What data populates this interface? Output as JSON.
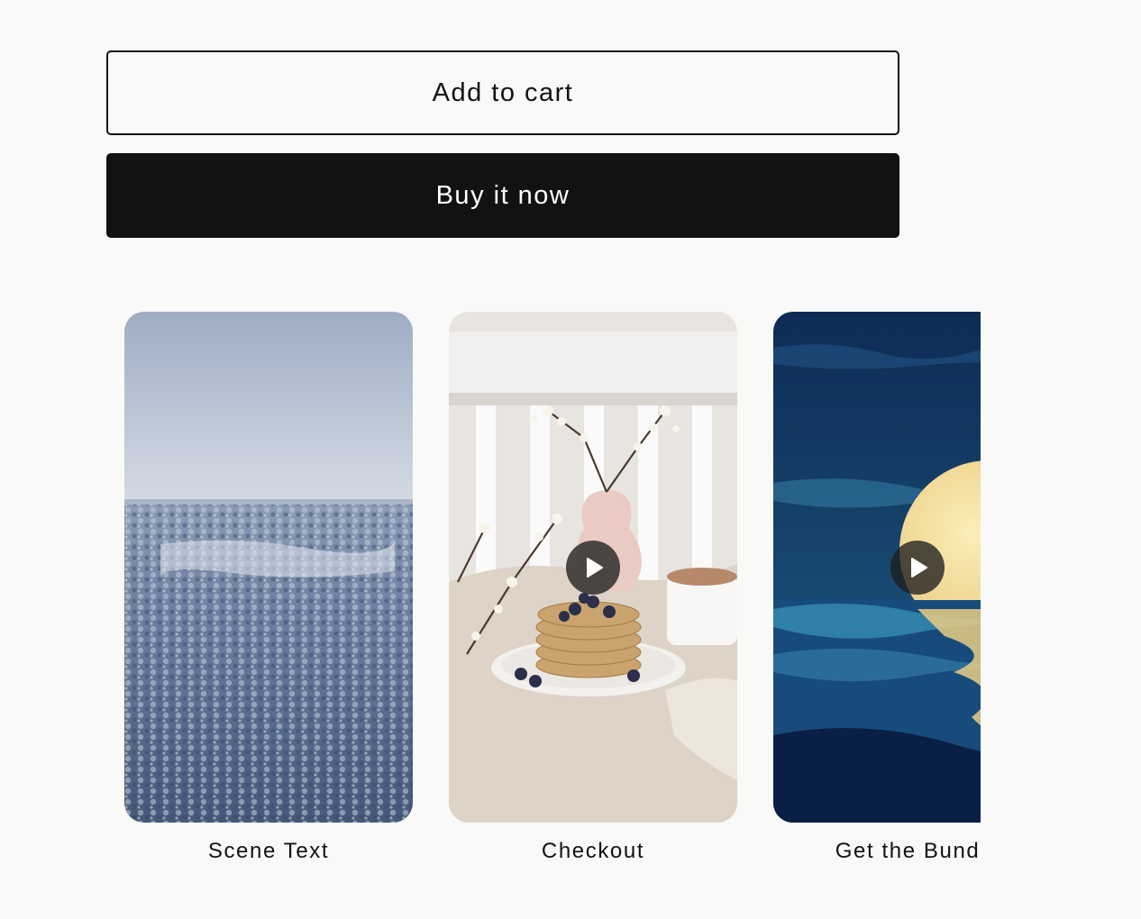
{
  "actions": {
    "add_to_cart_label": "Add to cart",
    "buy_now_label": "Buy it now"
  },
  "videos": [
    {
      "caption": "Scene Text",
      "thumbnail": "snowy-forest-landscape",
      "has_play_icon": false
    },
    {
      "caption": "Checkout",
      "thumbnail": "pancakes-breakfast",
      "has_play_icon": true,
      "icon": "play-icon"
    },
    {
      "caption": "Get the Bundle",
      "thumbnail": "moon-over-sea-illustration",
      "has_play_icon": true,
      "icon": "play-icon"
    }
  ],
  "colors": {
    "background": "#f9f9f7",
    "primary": "#121212",
    "on_primary": "#ffffff"
  }
}
